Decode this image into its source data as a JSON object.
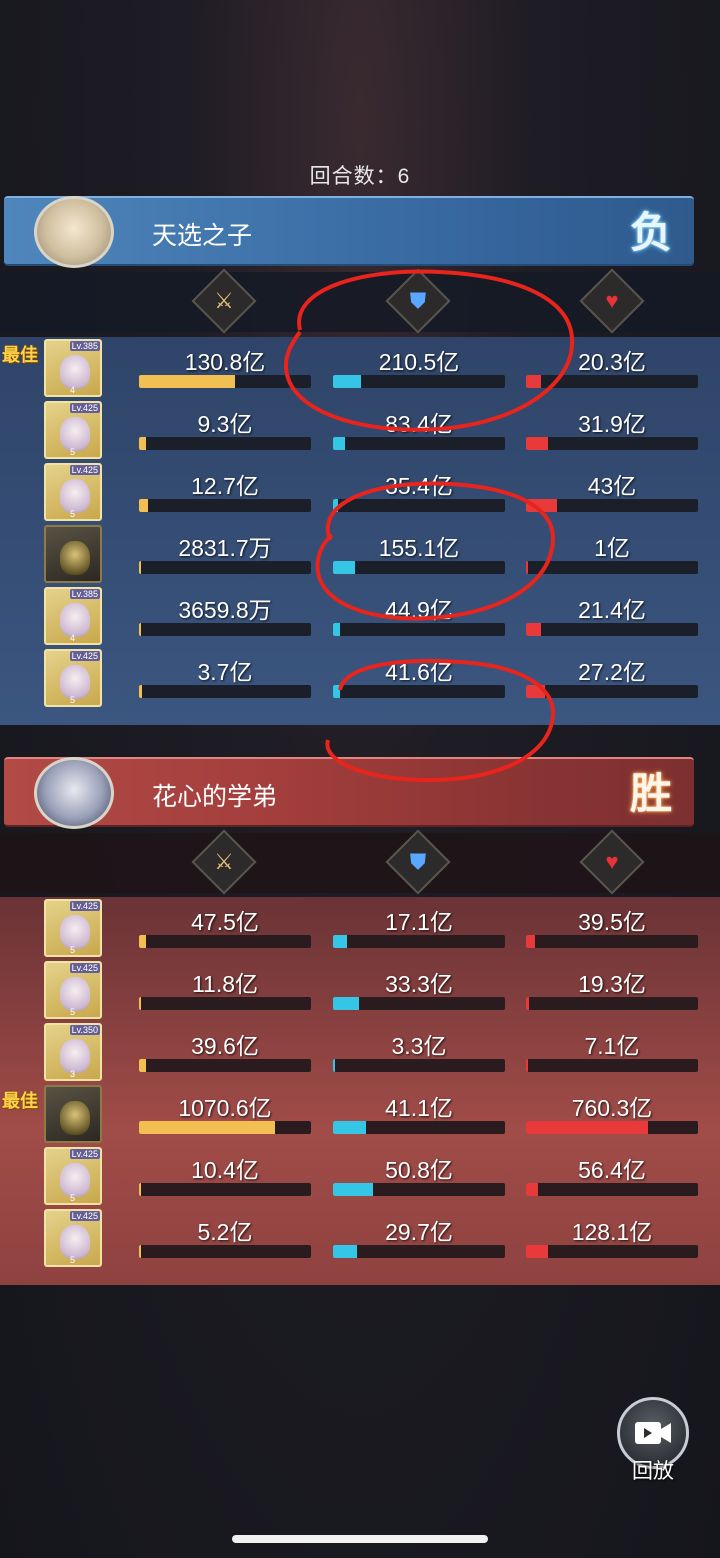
{
  "round": {
    "label": "回合数：6"
  },
  "best_label": "最佳",
  "team_a": {
    "name": "天选之子",
    "result": "负",
    "rows": [
      {
        "level": "Lv.385",
        "stars": "4",
        "best": true,
        "atk": "130.8亿",
        "def": "210.5亿",
        "hp": "20.3亿",
        "atk_pct": 56,
        "def_pct": 16,
        "hp_pct": 9
      },
      {
        "level": "Lv.425",
        "stars": "5",
        "best": false,
        "atk": "9.3亿",
        "def": "83.4亿",
        "hp": "31.9亿",
        "atk_pct": 4,
        "def_pct": 7,
        "hp_pct": 13
      },
      {
        "level": "Lv.425",
        "stars": "5",
        "best": false,
        "atk": "12.7亿",
        "def": "35.4亿",
        "hp": "43亿",
        "atk_pct": 5,
        "def_pct": 3,
        "hp_pct": 18
      },
      {
        "level": "",
        "stars": "",
        "best": false,
        "atk": "2831.7万",
        "def": "155.1亿",
        "hp": "1亿",
        "atk_pct": 1,
        "def_pct": 13,
        "hp_pct": 1
      },
      {
        "level": "Lv.385",
        "stars": "4",
        "best": false,
        "atk": "3659.8万",
        "def": "44.9亿",
        "hp": "21.4亿",
        "atk_pct": 1,
        "def_pct": 4,
        "hp_pct": 9
      },
      {
        "level": "Lv.425",
        "stars": "5",
        "best": false,
        "atk": "3.7亿",
        "def": "41.6亿",
        "hp": "27.2亿",
        "atk_pct": 2,
        "def_pct": 4,
        "hp_pct": 11
      }
    ]
  },
  "team_b": {
    "name": "花心的学弟",
    "result": "胜",
    "rows": [
      {
        "level": "Lv.425",
        "stars": "5",
        "best": false,
        "atk": "47.5亿",
        "def": "17.1亿",
        "hp": "39.5亿",
        "atk_pct": 4,
        "def_pct": 8,
        "hp_pct": 5
      },
      {
        "level": "Lv.425",
        "stars": "5",
        "best": false,
        "atk": "11.8亿",
        "def": "33.3亿",
        "hp": "19.3亿",
        "atk_pct": 1,
        "def_pct": 15,
        "hp_pct": 2
      },
      {
        "level": "Lv.350",
        "stars": "3",
        "best": false,
        "atk": "39.6亿",
        "def": "3.3亿",
        "hp": "7.1亿",
        "atk_pct": 4,
        "def_pct": 1,
        "hp_pct": 1
      },
      {
        "level": "",
        "stars": "",
        "best": true,
        "atk": "1070.6亿",
        "def": "41.1亿",
        "hp": "760.3亿",
        "atk_pct": 79,
        "def_pct": 19,
        "hp_pct": 71
      },
      {
        "level": "Lv.425",
        "stars": "5",
        "best": false,
        "atk": "10.4亿",
        "def": "50.8亿",
        "hp": "56.4亿",
        "atk_pct": 1,
        "def_pct": 23,
        "hp_pct": 7
      },
      {
        "level": "Lv.425",
        "stars": "5",
        "best": false,
        "atk": "5.2亿",
        "def": "29.7亿",
        "hp": "128.1亿",
        "atk_pct": 1,
        "def_pct": 14,
        "hp_pct": 13
      }
    ]
  },
  "replay": {
    "label": "回放"
  },
  "icons": {
    "attack": "sword-icon",
    "defense": "shield-icon",
    "health": "heart-icon",
    "replay": "video-icon"
  },
  "colors": {
    "attack_bar": "#f1bf52",
    "defense_bar": "#35c6e6",
    "health_bar": "#e83a3a",
    "annotation": "#e8241c"
  }
}
